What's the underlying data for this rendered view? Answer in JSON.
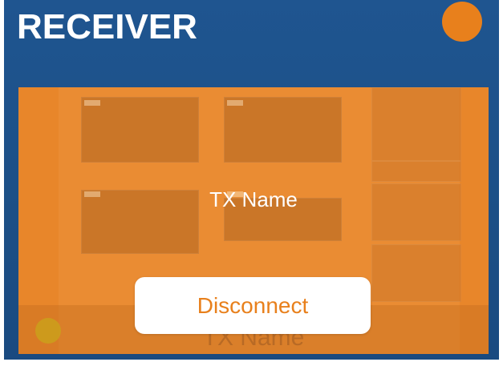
{
  "header": {
    "title": "RECEIVER"
  },
  "status": {
    "dot_color": "#e8801c"
  },
  "preview": {
    "tx_name": "TX Name",
    "tx_name_background": "TX Name",
    "overlay_color": "#e8862a"
  },
  "actions": {
    "disconnect_label": "Disconnect"
  },
  "colors": {
    "background": "#1f5590",
    "accent": "#e8801c",
    "button_bg": "#ffffff"
  }
}
